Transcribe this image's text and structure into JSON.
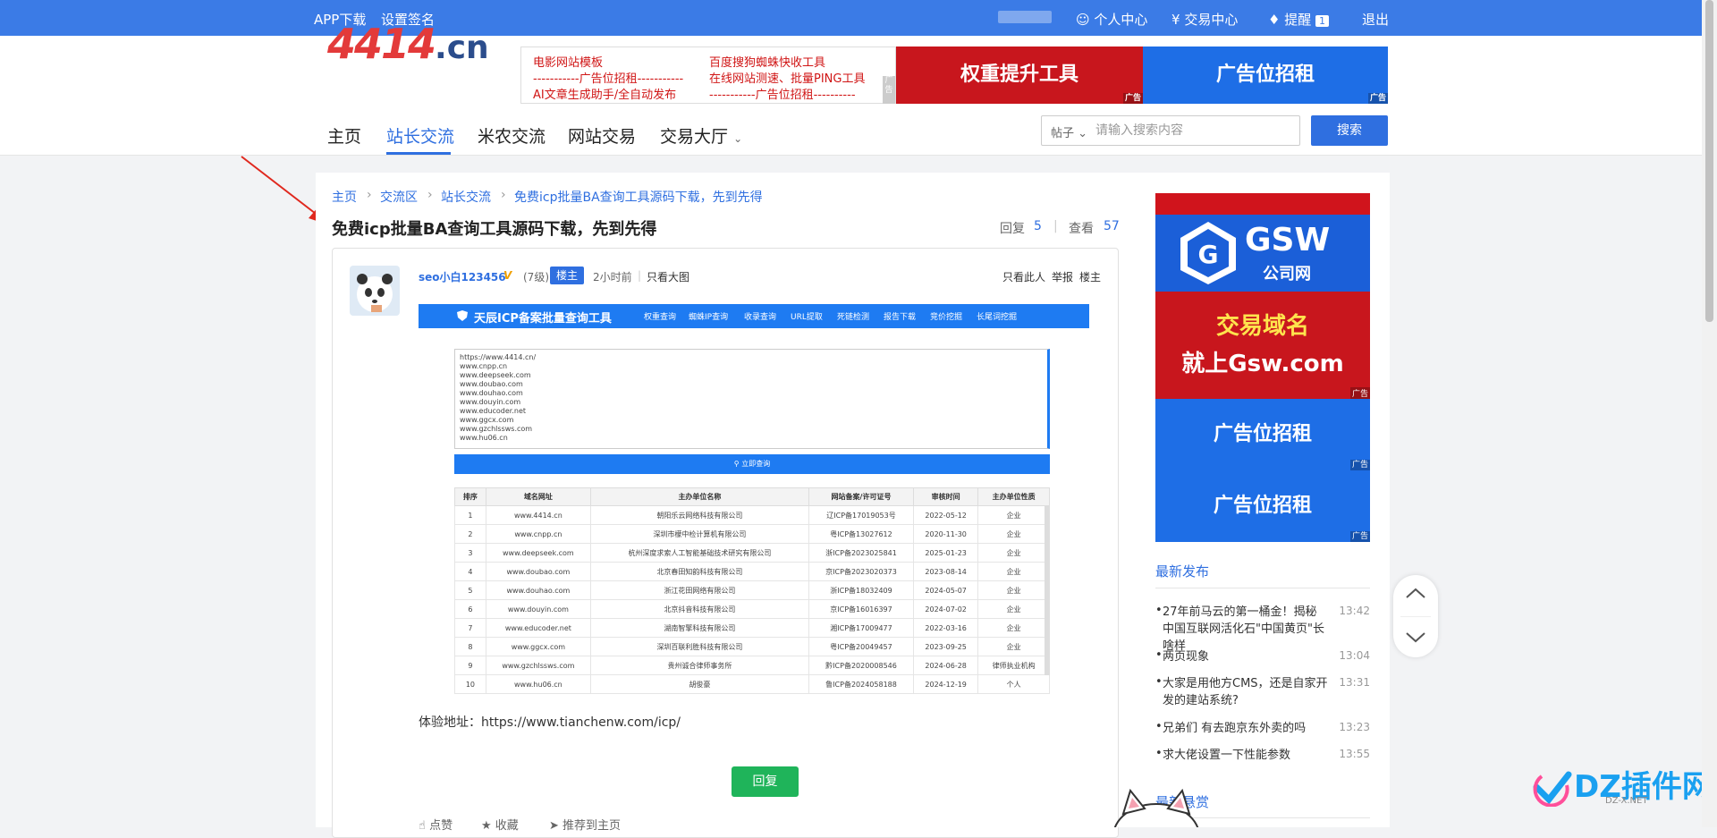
{
  "topbar": {
    "app_download": "APP下载",
    "set_sign": "设置签名",
    "personal_center": "个人中心",
    "trade_center": "交易中心",
    "remind": "提醒",
    "remind_count": "1",
    "logout": "退出"
  },
  "logo": {
    "main": "4414",
    "suffix": ".cn"
  },
  "banner_text": {
    "l1": "电影网站模板",
    "l2": "-----------广告位招租-----------",
    "l3": "AI文章生成助手/全自动发布",
    "r1": "百度搜狗蜘蛛快收工具",
    "r2": "在线网站测速、批量PING工具",
    "r3": "-----------广告位招租----------",
    "flag": "广告"
  },
  "banner_red": "权重提升工具",
  "banner_blue": "广告位招租",
  "ad_flag": "广告",
  "nav": [
    "主页",
    "站长交流",
    "米农交流",
    "网站交易",
    "交易大厅"
  ],
  "search": {
    "select": "帖子",
    "placeholder": "请输入搜索内容",
    "button": "搜索"
  },
  "breadcrumb": [
    "主页",
    "交流区",
    "站长交流",
    "免费icp批量BA查询工具源码下载，先到先得"
  ],
  "post": {
    "title": "免费icp批量BA查询工具源码下载，先到先得",
    "reply_label": "回复",
    "reply_count": "5",
    "view_label": "查看",
    "view_count": "57",
    "author": "seo小白123456",
    "level": "(7级)",
    "lz_badge": "楼主",
    "time": "2小时前",
    "view_big": "只看大图",
    "only_author": "只看此人",
    "report": "举报",
    "floor": "楼主",
    "demo": "体验地址：https://www.tianchenw.com/icp/",
    "reply_btn": "回复",
    "like": "点赞",
    "fav": "收藏",
    "recommend": "推荐到主页"
  },
  "shot": {
    "title": "天辰ICP备案批量查询工具",
    "nav": [
      "权重查询",
      "蜘蛛IP查询",
      "收录查询",
      "URL提取",
      "死链检测",
      "报告下载",
      "竞价挖掘",
      "长尾词挖掘"
    ],
    "domains": [
      "https://www.4414.cn/",
      "www.cnpp.cn",
      "www.deepseek.com",
      "www.doubao.com",
      "www.douhao.com",
      "www.douyin.com",
      "www.educoder.net",
      "www.ggcx.com",
      "www.gzchlssws.com",
      "www.hu06.cn"
    ],
    "query_btn": "立即查询",
    "headers": [
      "排序",
      "域名网址",
      "主办单位名称",
      "网站备案/许可证号",
      "审核时间",
      "主办单位性质"
    ],
    "rows": [
      [
        "1",
        "www.4414.cn",
        "朝阳乐云网络科技有限公司",
        "辽ICP备17019053号",
        "2022-05-12",
        "企业"
      ],
      [
        "2",
        "www.cnpp.cn",
        "深圳市檬中检计算机有限公司",
        "粤ICP备13027612",
        "2020-11-30",
        "企业"
      ],
      [
        "3",
        "www.deepseek.com",
        "杭州深度求索人工智能基础技术研究有限公司",
        "浙ICP备2023025841",
        "2025-01-23",
        "企业"
      ],
      [
        "4",
        "www.doubao.com",
        "北京春田知韵科技有限公司",
        "京ICP备2023020373",
        "2023-08-14",
        "企业"
      ],
      [
        "5",
        "www.douhao.com",
        "浙江花田网络有限公司",
        "浙ICP备18032409",
        "2024-05-07",
        "企业"
      ],
      [
        "6",
        "www.douyin.com",
        "北京抖音科技有限公司",
        "京ICP备16016397",
        "2024-07-02",
        "企业"
      ],
      [
        "7",
        "www.educoder.net",
        "湖南智擎科技有限公司",
        "湘ICP备17009477",
        "2022-03-16",
        "企业"
      ],
      [
        "8",
        "www.ggcx.com",
        "深圳百联利胜科技有限公司",
        "粤ICP备20049457",
        "2023-09-25",
        "企业"
      ],
      [
        "9",
        "www.gzchlssws.com",
        "贵州诚合律师事务所",
        "黔ICP备2020008546",
        "2024-06-28",
        "律师执业机构"
      ],
      [
        "10",
        "www.hu06.cn",
        "胡俊豪",
        "鲁ICP备2024058188",
        "2024-12-19",
        "个人"
      ]
    ]
  },
  "sidebar": {
    "gsw_logo": "GSW",
    "gsw_sub": "公司网",
    "red_ad_l1": "交易域名",
    "red_ad_l2": "就上Gsw.com",
    "blue_ad": "广告位招租",
    "latest_title": "最新发布",
    "latest": [
      {
        "text": "27年前马云的第一桶金！揭秘中国互联网活化石\"中国黄页\"长啥样",
        "time": "13:42"
      },
      {
        "text": "两页现象",
        "time": "13:04"
      },
      {
        "text": "大家是用他方CMS，还是自家开发的建站系统?",
        "time": "13:31"
      },
      {
        "text": "兄弟们 有去跑京东外卖的吗",
        "time": "13:23"
      },
      {
        "text": "求大佬设置一下性能参数",
        "time": "13:55"
      }
    ],
    "bounty_title": "最新悬赏"
  },
  "watermark": {
    "main": "DZ插件网",
    "sub": "DZ-X.NET"
  },
  "colors": {
    "topbar": "#3b7be6",
    "accent": "#2f6fe0",
    "reply": "#1fb45a",
    "ad_red": "#c8161d"
  }
}
